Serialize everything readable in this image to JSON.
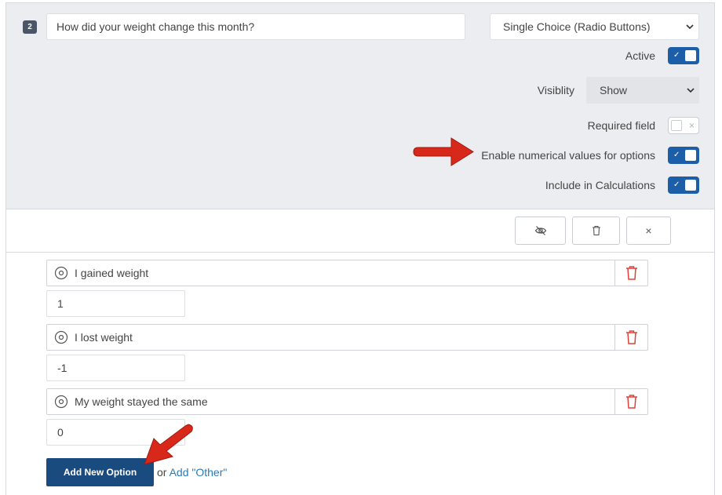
{
  "question": {
    "number": "2",
    "text": "How did your weight change this month?",
    "type": "Single Choice (Radio Buttons)"
  },
  "settings": {
    "active_label": "Active",
    "visibility_label": "Visiblity",
    "visibility_value": "Show",
    "required_label": "Required field",
    "numerical_label": "Enable numerical values for options",
    "calculations_label": "Include in Calculations"
  },
  "actions": {
    "hide_icon": "eye-slash-icon",
    "delete_icon": "trash-icon",
    "close_label": "×"
  },
  "options": [
    {
      "label": "I gained weight",
      "value": "1"
    },
    {
      "label": "I lost weight",
      "value": "-1"
    },
    {
      "label": "My weight stayed the same",
      "value": "0"
    }
  ],
  "footer": {
    "add_option_label": "Add New Option",
    "or_text": "or",
    "add_other_label": "Add \"Other\""
  },
  "colors": {
    "toggle_on": "#1d5ea8",
    "add_button": "#1a4b7f",
    "delete_icon": "#e0403a",
    "link": "#2a7ab8",
    "annotation_arrow": "#d8281a"
  }
}
